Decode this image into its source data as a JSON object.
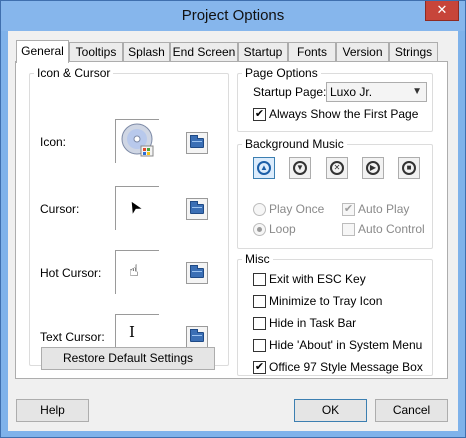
{
  "window": {
    "title": "Project Options",
    "close_glyph": "✕"
  },
  "tabs": [
    {
      "label": "General"
    },
    {
      "label": "Tooltips"
    },
    {
      "label": "Splash"
    },
    {
      "label": "End Screen"
    },
    {
      "label": "Startup"
    },
    {
      "label": "Fonts"
    },
    {
      "label": "Version"
    },
    {
      "label": "Strings"
    }
  ],
  "active_tab": "General",
  "icon_cursor": {
    "legend": "Icon & Cursor",
    "icon_label": "Icon:",
    "cursor_label": "Cursor:",
    "hot_cursor_label": "Hot Cursor:",
    "text_cursor_label": "Text Cursor:",
    "restore_button": "Restore Default Settings"
  },
  "page_options": {
    "legend": "Page Options",
    "startup_page_label": "Startup Page:",
    "startup_page_value": "Luxo Jr.",
    "always_show_first": "Always Show the First Page",
    "always_show_first_checked": true
  },
  "background_music": {
    "legend": "Background Music",
    "buttons": [
      "eject-icon",
      "down-icon",
      "close-icon",
      "play-icon",
      "stop-icon"
    ],
    "play_once": "Play Once",
    "loop": "Loop",
    "loop_selected": true,
    "auto_play": "Auto Play",
    "auto_play_checked": true,
    "auto_control": "Auto Control",
    "auto_control_checked": false
  },
  "misc": {
    "legend": "Misc",
    "items": [
      {
        "label": "Exit with ESC Key",
        "checked": false
      },
      {
        "label": "Minimize to Tray Icon",
        "checked": false
      },
      {
        "label": "Hide in Task Bar",
        "checked": false
      },
      {
        "label": "Hide 'About' in System Menu",
        "checked": false
      },
      {
        "label": "Office 97 Style Message Box",
        "checked": true
      }
    ]
  },
  "footer": {
    "help": "Help",
    "ok": "OK",
    "cancel": "Cancel"
  },
  "glyphs": {
    "check": "✔",
    "arrow": "▼",
    "cursor_arrow": "➤",
    "hand": "☝",
    "ibeam": "I"
  },
  "colors": {
    "title_bar": "#86b6ec",
    "close_button": "#c7453a",
    "accent": "#3c7fb1"
  }
}
